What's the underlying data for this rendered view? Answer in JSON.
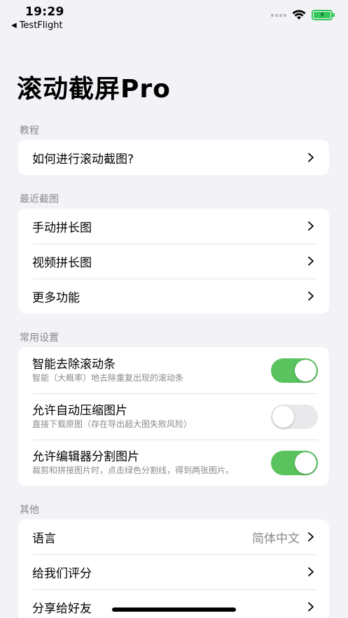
{
  "status_bar": {
    "time": "19:29",
    "back_app": "TestFlight",
    "battery_color": "#34c759"
  },
  "page_title": "滚动截屏Pro",
  "sections": {
    "tutorial": {
      "header": "教程",
      "items": [
        {
          "label": "如何进行滚动截图?"
        }
      ]
    },
    "recent": {
      "header": "最近截图",
      "items": [
        {
          "label": "手动拼长图"
        },
        {
          "label": "视频拼长图"
        },
        {
          "label": "更多功能"
        }
      ]
    },
    "settings": {
      "header": "常用设置",
      "items": [
        {
          "title": "智能去除滚动条",
          "subtitle": "智能（大概率）地去除重复出现的滚动条",
          "on": true
        },
        {
          "title": "允许自动压缩图片",
          "subtitle": "直接下载原图（存在导出超大图失败风险）",
          "on": false
        },
        {
          "title": "允许编辑器分割图片",
          "subtitle": "裁剪和拼接图片时，点击绿色分割线，得到两张图片。",
          "on": true
        }
      ]
    },
    "other": {
      "header": "其他",
      "items": [
        {
          "label": "语言",
          "value": "简体中文"
        },
        {
          "label": "给我们评分"
        },
        {
          "label": "分享给好友"
        }
      ]
    }
  },
  "colors": {
    "accent_green": "#5ac35e",
    "background": "#f2f2f7",
    "secondary_text": "#8a8a8e"
  }
}
